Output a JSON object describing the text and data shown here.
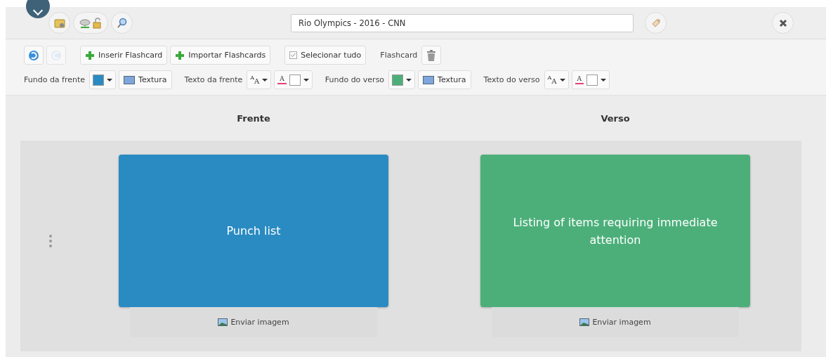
{
  "header": {
    "icon_buttons": [
      {
        "kind": "folder"
      },
      {
        "kind": "cloud-lock"
      },
      {
        "kind": "search"
      }
    ],
    "title_value": "Rio Olympics - 2016 - CNN"
  },
  "toolbar": {
    "history": [
      {
        "kind": "undo",
        "disabled": false
      },
      {
        "kind": "redo",
        "disabled": true
      }
    ],
    "actions": [
      {
        "kind": "plus",
        "label": "Inserir Flashcard"
      },
      {
        "kind": "plus",
        "label": "Importar Flashcards"
      },
      {
        "kind": "check",
        "label": "Selecionar tudo"
      }
    ],
    "flashcard_label": "Flashcard",
    "styles": [
      {
        "background_label": "Fundo da frente",
        "background_swatch": {
          "color": "#2a8bc2"
        },
        "texture_label": "Textura",
        "text_label": "Texto da frente",
        "font_size_glyphs": [
          "A",
          "A"
        ],
        "text_color_glyph": "A",
        "text_swatch": {
          "color": "#ffffff"
        }
      },
      {
        "background_label": "Fundo do verso",
        "background_swatch": {
          "color": "#4caf7a"
        },
        "texture_label": "Textura",
        "text_label": "Texto do verso",
        "font_size_glyphs": [
          "A",
          "A"
        ],
        "text_color_glyph": "A",
        "text_swatch": {
          "color": "#ffffff"
        }
      }
    ]
  },
  "columns": [
    "Frente",
    "Verso"
  ],
  "cards": [
    {
      "text": "Punch list",
      "color": "#2a8bc2",
      "upload_label": "Enviar imagem"
    },
    {
      "text": "Listing of items requiring immediate attention",
      "color": "#4caf7a",
      "upload_label": "Enviar imagem"
    }
  ]
}
